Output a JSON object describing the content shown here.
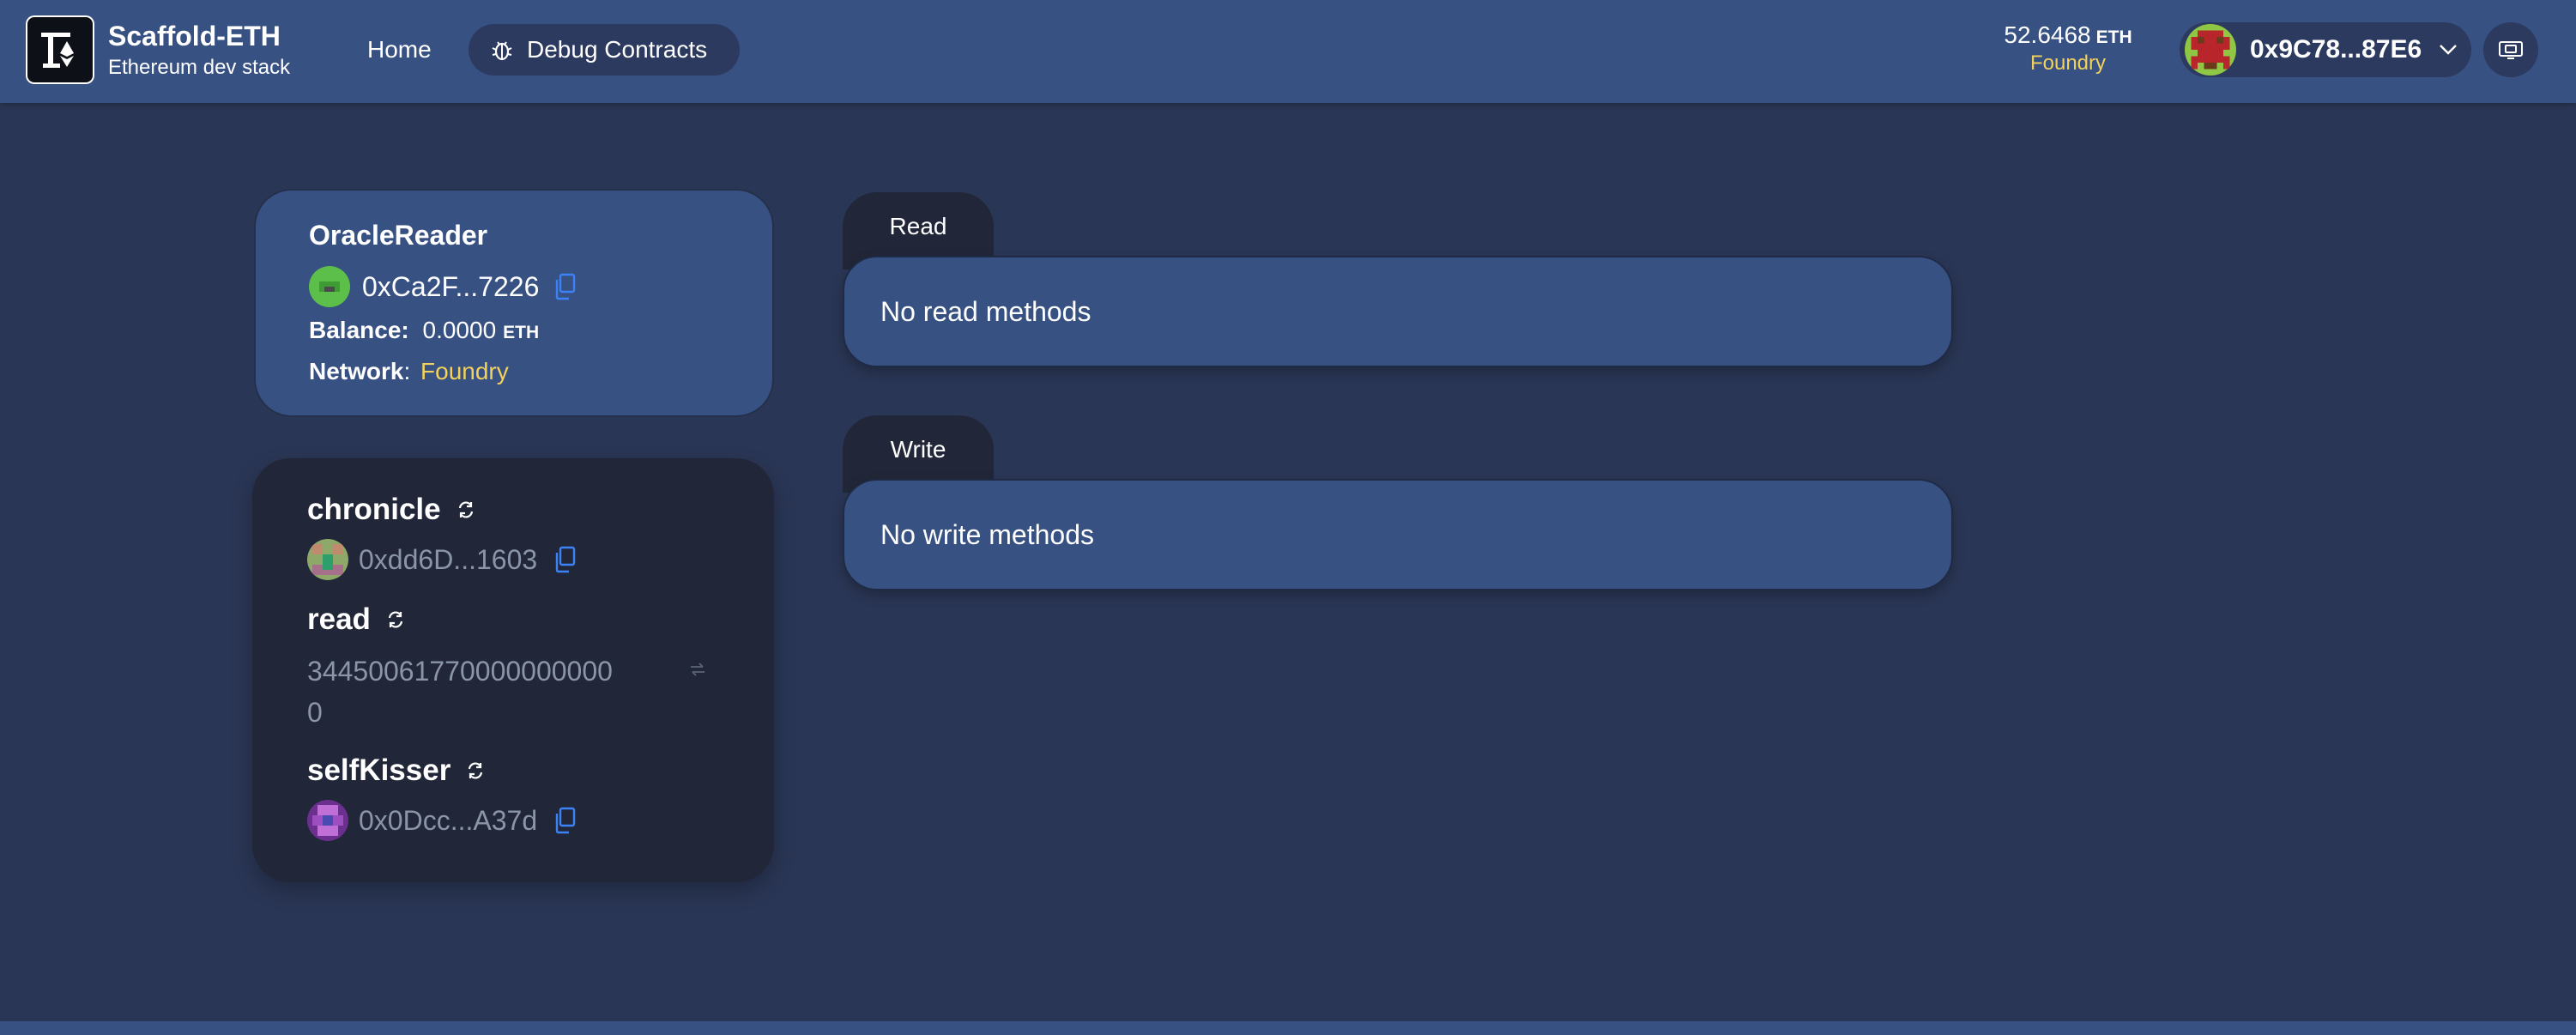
{
  "header": {
    "brand_title": "Scaffold-ETH",
    "brand_subtitle": "Ethereum dev stack",
    "nav": {
      "home_label": "Home",
      "debug_label": "Debug Contracts"
    },
    "balance": {
      "amount": "52.6468",
      "unit": "ETH",
      "network": "Foundry"
    },
    "account": {
      "address": "0x9C78...87E6"
    }
  },
  "contract": {
    "name": "OracleReader",
    "address": "0xCa2F...7226",
    "balance_label": "Balance:",
    "balance_value": "0.0000",
    "balance_unit": "ETH",
    "network_label": "Network",
    "network_colon": ":",
    "network_value": "Foundry"
  },
  "variables": [
    {
      "name": "chronicle",
      "address": "0xdd6D...1603"
    },
    {
      "name": "read",
      "value_line1": "34450061770000000000",
      "value_line2": "0"
    },
    {
      "name": "selfKisser",
      "address": "0x0Dcc...A37d"
    }
  ],
  "read_panel": {
    "tab_label": "Read",
    "empty_text": "No read methods"
  },
  "write_panel": {
    "tab_label": "Write",
    "empty_text": "No write methods"
  },
  "colors": {
    "header_bg": "#385183",
    "page_bg": "#2a3655",
    "card_dark": "#212738",
    "accent_yellow": "#f2d15c",
    "copy_blue": "#3b82f6"
  }
}
